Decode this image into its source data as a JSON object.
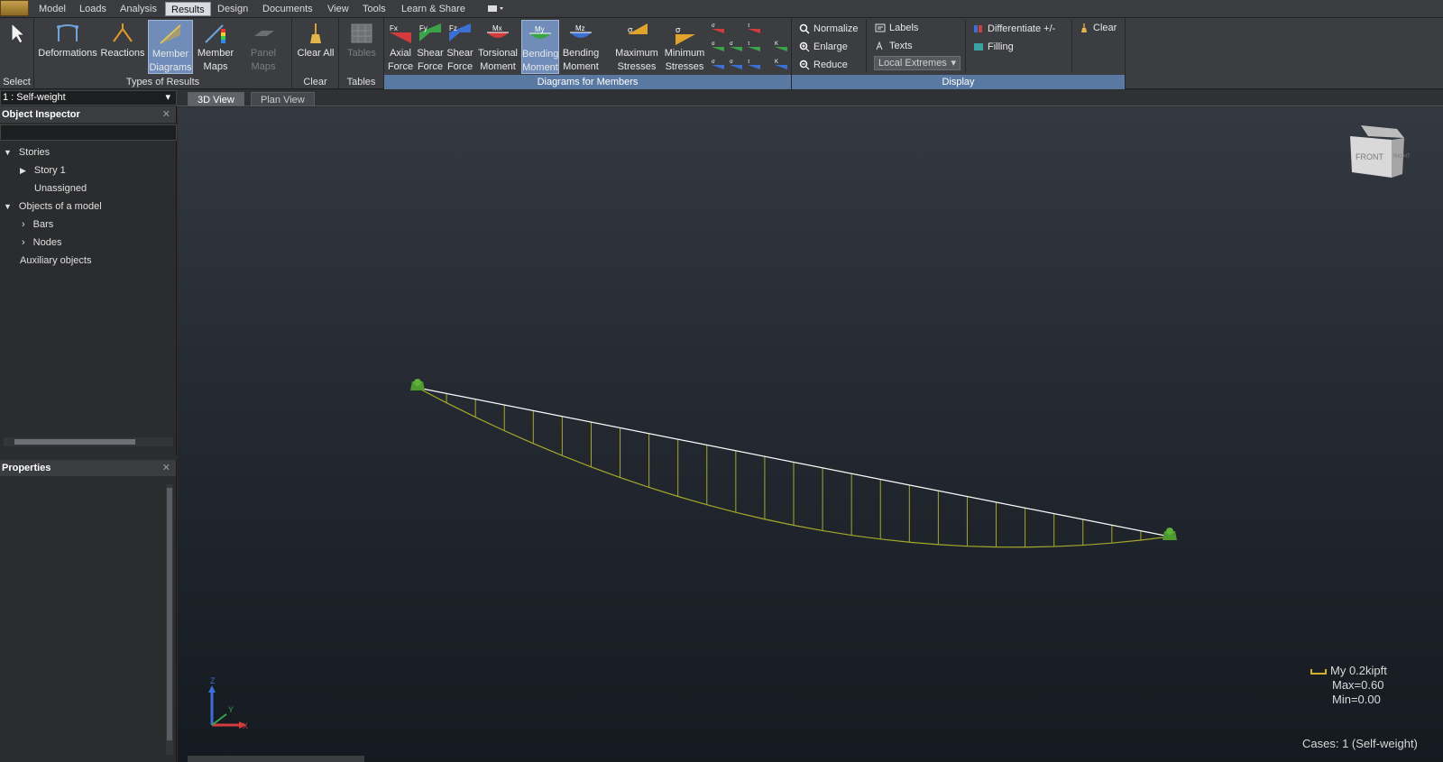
{
  "menu": {
    "tabs": [
      {
        "label": "Model"
      },
      {
        "label": "Loads"
      },
      {
        "label": "Analysis"
      },
      {
        "label": "Results"
      },
      {
        "label": "Design"
      },
      {
        "label": "Documents"
      },
      {
        "label": "View"
      },
      {
        "label": "Tools"
      },
      {
        "label": "Learn & Share"
      }
    ],
    "active_tab": "Results"
  },
  "ribbon": {
    "select_label": "Select",
    "types_group": {
      "label": "Types of Results",
      "buttons": [
        {
          "label": "Deformations"
        },
        {
          "label": "Reactions"
        },
        {
          "label": "Member Diagrams"
        },
        {
          "label": "Member Maps"
        },
        {
          "label": "Panel Maps"
        }
      ]
    },
    "clear_group": {
      "label": "Clear",
      "button": "Clear All"
    },
    "tables_group": {
      "label": "Tables",
      "button": "Tables"
    },
    "diagrams_group": {
      "label": "Diagrams for Members",
      "buttons": [
        {
          "line1": "Axial",
          "line2": "Force",
          "icon_text": "Fx"
        },
        {
          "line1": "Shear",
          "line2": "Force",
          "icon_text": "Fy"
        },
        {
          "line1": "Shear",
          "line2": "Force",
          "icon_text": "Fz"
        },
        {
          "line1": "Torsional",
          "line2": "Moment",
          "icon_text": "Mx"
        },
        {
          "line1": "Bending",
          "line2": "Moment",
          "icon_text": "My"
        },
        {
          "line1": "Bending",
          "line2": "Moment",
          "icon_text": "Mz"
        },
        {
          "line1": "Maximum",
          "line2": "Stresses",
          "icon_text": "σ"
        },
        {
          "line1": "Minimum",
          "line2": "Stresses",
          "icon_text": "σ"
        }
      ]
    },
    "display_group": {
      "label": "Display",
      "normalize": "Normalize",
      "enlarge": "Enlarge",
      "reduce": "Reduce",
      "labels": "Labels",
      "texts": "Texts",
      "extremes": "Local Extremes",
      "differentiate": "Differentiate +/-",
      "filling": "Filling",
      "clear": "Clear"
    }
  },
  "load_case": "1 : Self-weight",
  "view_tabs": [
    {
      "label": "3D View"
    },
    {
      "label": "Plan View"
    }
  ],
  "object_inspector": {
    "title": "Object Inspector",
    "items": [
      {
        "label": "Stories"
      },
      {
        "label": "Story 1"
      },
      {
        "label": "Unassigned"
      },
      {
        "label": "Objects of a model"
      },
      {
        "label": "Bars"
      },
      {
        "label": "Nodes"
      },
      {
        "label": "Auxiliary objects"
      }
    ]
  },
  "properties": {
    "title": "Properties"
  },
  "viewcube": {
    "front": "FRONT",
    "right": "RIGHT"
  },
  "axes": {
    "z": "Z",
    "y": "Y",
    "x": "X"
  },
  "legend": {
    "line1": "My  0.2kipft",
    "line2": "Max=0.60",
    "line3": "Min=0.00"
  },
  "cases": "Cases: 1 (Self-weight)",
  "colors": {
    "diagram": "#a5a82a",
    "beam": "#ffffff",
    "support": "#4f9a2e",
    "active_tab": "#6f8db8"
  }
}
